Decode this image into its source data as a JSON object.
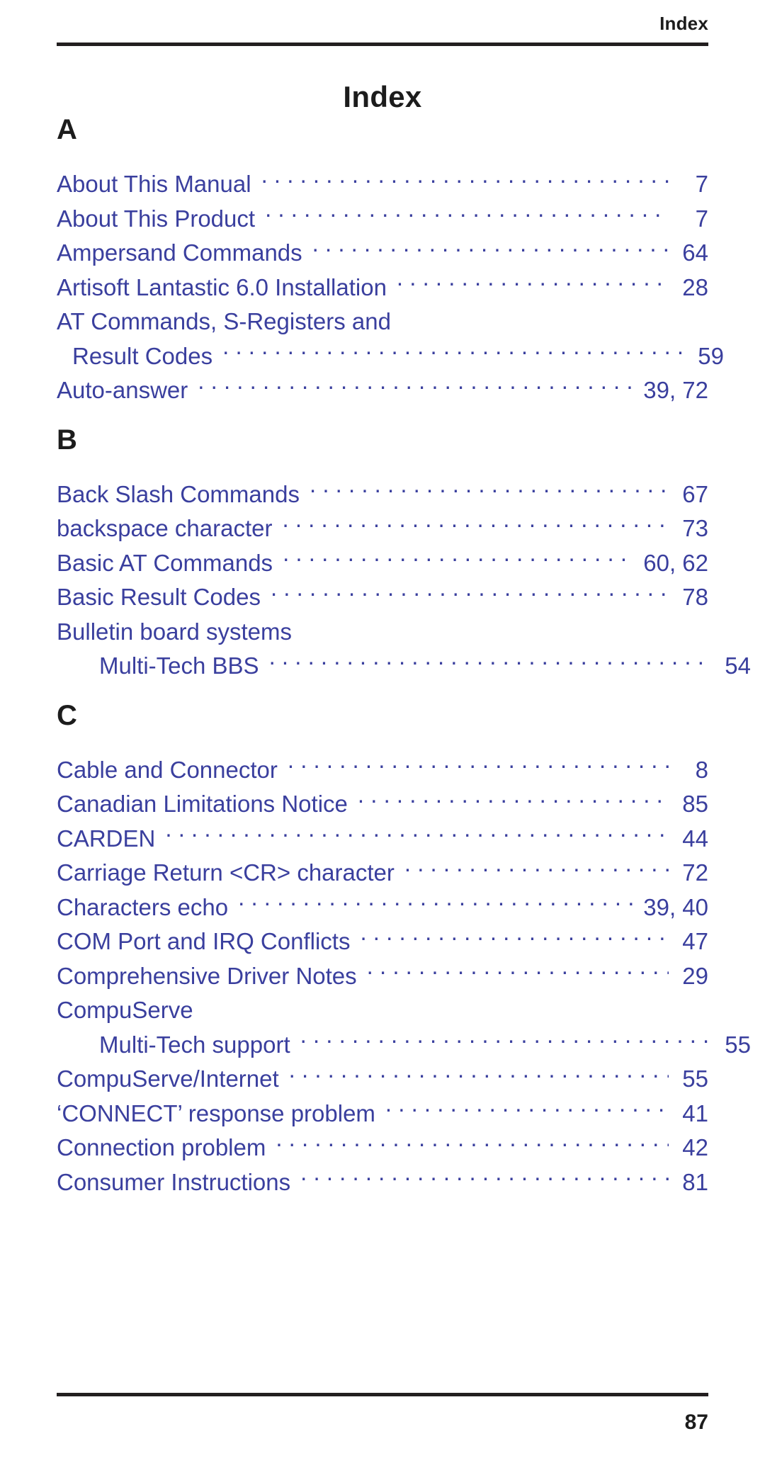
{
  "header": {
    "running_title": "Index"
  },
  "title": "Index",
  "footer": {
    "page_number": "87"
  },
  "colors": {
    "entry_blue": "#3a3f9e",
    "heading_black": "#1c1c1c",
    "rule": "#231f20",
    "background": "#ffffff"
  },
  "sections": [
    {
      "letter": "A",
      "entries": [
        {
          "label": "About This Manual",
          "pages": "7",
          "indent": 0,
          "leader": true
        },
        {
          "label": "About This Product",
          "pages": "7",
          "indent": 0,
          "leader": true
        },
        {
          "label": "Ampersand Commands",
          "pages": "64",
          "indent": 0,
          "leader": true
        },
        {
          "label": "Artisoft Lantastic 6.0 Installation",
          "pages": "28",
          "indent": 0,
          "leader": true
        },
        {
          "label": "AT Commands, S-Registers and",
          "pages": "",
          "indent": 0,
          "leader": false
        },
        {
          "label": "Result Codes",
          "pages": "59",
          "indent": 1,
          "leader": true
        },
        {
          "label": "Auto-answer",
          "pages": "39,  72",
          "indent": 0,
          "leader": true
        }
      ]
    },
    {
      "letter": "B",
      "entries": [
        {
          "label": "Back Slash Commands",
          "pages": "67",
          "indent": 0,
          "leader": true
        },
        {
          "label": "backspace character",
          "pages": "73",
          "indent": 0,
          "leader": true
        },
        {
          "label": "Basic AT Commands",
          "pages": "60,  62",
          "indent": 0,
          "leader": true
        },
        {
          "label": "Basic Result Codes",
          "pages": "78",
          "indent": 0,
          "leader": true
        },
        {
          "label": "Bulletin board systems",
          "pages": "",
          "indent": 0,
          "leader": false
        },
        {
          "label": "Multi-Tech BBS",
          "pages": "54",
          "indent": 2,
          "leader": true
        }
      ]
    },
    {
      "letter": "C",
      "entries": [
        {
          "label": "Cable and Connector",
          "pages": "8",
          "indent": 0,
          "leader": true
        },
        {
          "label": "Canadian Limitations Notice",
          "pages": "85",
          "indent": 0,
          "leader": true
        },
        {
          "label": "CARDEN",
          "pages": "44",
          "indent": 0,
          "leader": true
        },
        {
          "label": "Carriage Return <CR> character",
          "pages": "72",
          "indent": 0,
          "leader": true
        },
        {
          "label": "Characters echo",
          "pages": "39,  40",
          "indent": 0,
          "leader": true
        },
        {
          "label": "COM Port and IRQ Conflicts",
          "pages": "47",
          "indent": 0,
          "leader": true
        },
        {
          "label": "Comprehensive Driver Notes",
          "pages": "29",
          "indent": 0,
          "leader": true
        },
        {
          "label": "CompuServe",
          "pages": "",
          "indent": 0,
          "leader": false
        },
        {
          "label": "Multi-Tech support",
          "pages": "55",
          "indent": 2,
          "leader": true
        },
        {
          "label": "CompuServe/Internet",
          "pages": "55",
          "indent": 0,
          "leader": true
        },
        {
          "label": "‘CONNECT’ response problem",
          "pages": "41",
          "indent": 0,
          "leader": true
        },
        {
          "label": "Connection problem",
          "pages": "42",
          "indent": 0,
          "leader": true
        },
        {
          "label": "Consumer Instructions",
          "pages": "81",
          "indent": 0,
          "leader": true
        }
      ]
    }
  ]
}
